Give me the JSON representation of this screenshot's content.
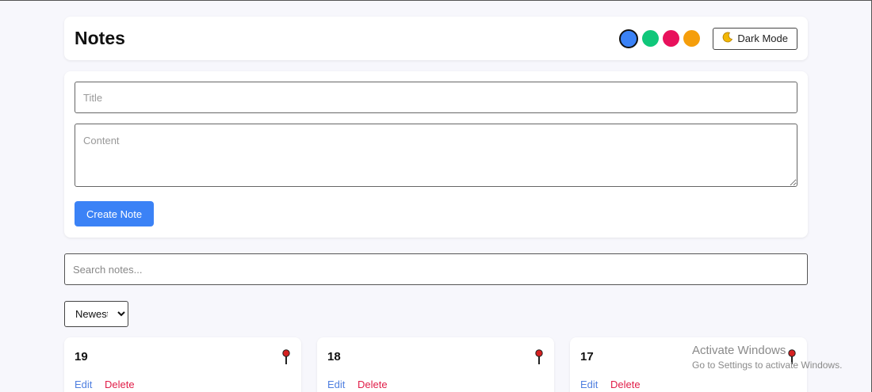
{
  "header": {
    "title": "Notes",
    "colors": [
      "#3b82f6",
      "#10c77a",
      "#e8115c",
      "#f59e0b"
    ],
    "active_color": "#3b82f6",
    "dark_mode_icon": "moon-icon",
    "dark_mode_label": "Dark Mode"
  },
  "form": {
    "title_placeholder": "Title",
    "content_placeholder": "Content",
    "create_label": "Create Note"
  },
  "search": {
    "placeholder": "Search notes..."
  },
  "sort": {
    "selected": "Newest"
  },
  "notes": [
    {
      "title": "19",
      "edit_label": "Edit",
      "delete_label": "Delete",
      "pin_icon": "pin-icon"
    },
    {
      "title": "18",
      "edit_label": "Edit",
      "delete_label": "Delete",
      "pin_icon": "pin-icon"
    },
    {
      "title": "17",
      "edit_label": "Edit",
      "delete_label": "Delete",
      "pin_icon": "pin-icon"
    }
  ],
  "watermark": {
    "line1": "Activate Windows",
    "line2": "Go to Settings to activate Windows."
  }
}
